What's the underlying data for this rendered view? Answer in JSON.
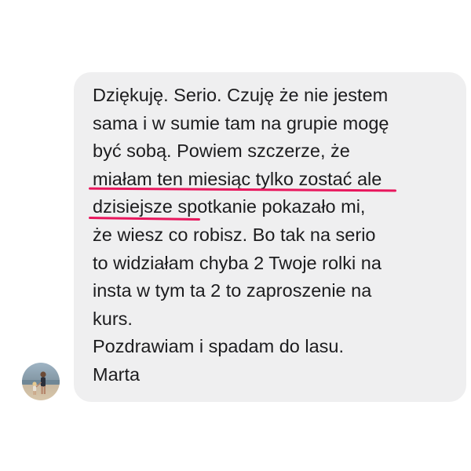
{
  "message": {
    "lines": [
      "Dziękuję.  Serio. Czuję że nie jestem",
      "sama i w sumie tam na grupie mogę",
      "być sobą. Powiem szczerze,  że",
      "miałam ten miesiąc tylko zostać ale",
      "dzisiejsze spotkanie pokazało mi,",
      "że wiesz co robisz. Bo tak na serio",
      "to widziałam chyba 2 Twoje rolki na",
      "insta w tym ta 2 to zaproszenie na",
      "kurs.",
      "Pozdrawiam i spadam do lasu.",
      "Marta"
    ]
  },
  "colors": {
    "bubble_background": "#efeff0",
    "text": "#1c1c1e",
    "underline_accent": "#e8175d"
  },
  "icons": {
    "avatar": "sender-avatar-photo"
  }
}
